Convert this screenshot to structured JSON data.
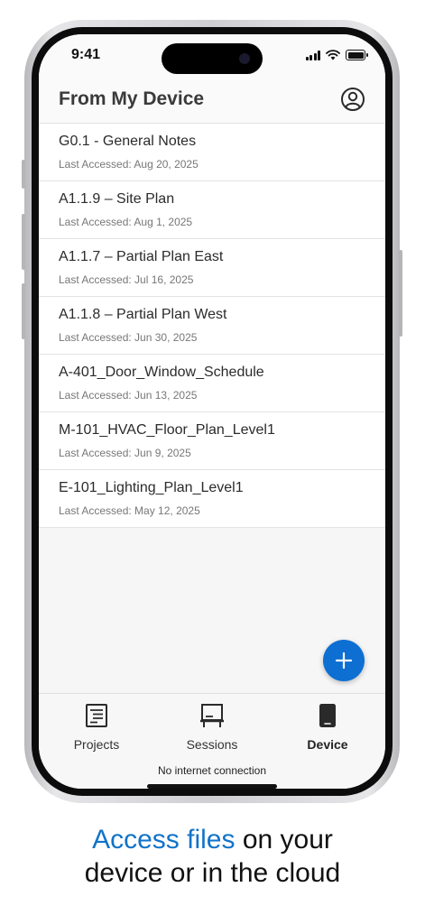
{
  "status_bar": {
    "time": "9:41"
  },
  "header": {
    "title": "From My Device"
  },
  "files": [
    {
      "name": "G0.1 - General Notes",
      "last_accessed": "Last Accessed: Aug 20, 2025"
    },
    {
      "name": "A1.1.9 – Site Plan",
      "last_accessed": "Last Accessed: Aug 1, 2025"
    },
    {
      "name": "A1.1.7 – Partial Plan East",
      "last_accessed": "Last Accessed: Jul 16, 2025"
    },
    {
      "name": "A1.1.8 – Partial Plan West",
      "last_accessed": "Last Accessed: Jun 30, 2025"
    },
    {
      "name": "A-401_Door_Window_Schedule",
      "last_accessed": "Last Accessed: Jun 13, 2025"
    },
    {
      "name": "M-101_HVAC_Floor_Plan_Level1",
      "last_accessed": "Last Accessed: Jun 9, 2025"
    },
    {
      "name": "E-101_Lighting_Plan_Level1",
      "last_accessed": "Last Accessed: May 12, 2025"
    }
  ],
  "tabs": [
    {
      "label": "Projects",
      "icon": "document-list-icon",
      "active": false
    },
    {
      "label": "Sessions",
      "icon": "workstation-icon",
      "active": false
    },
    {
      "label": "Device",
      "icon": "phone-icon",
      "active": true
    }
  ],
  "status_message": "No internet connection",
  "caption": {
    "highlight": "Access files",
    "rest_line1": " on your",
    "line2": "device or in the cloud"
  },
  "colors": {
    "accent": "#0d6fd1",
    "caption_highlight": "#1173c9"
  }
}
